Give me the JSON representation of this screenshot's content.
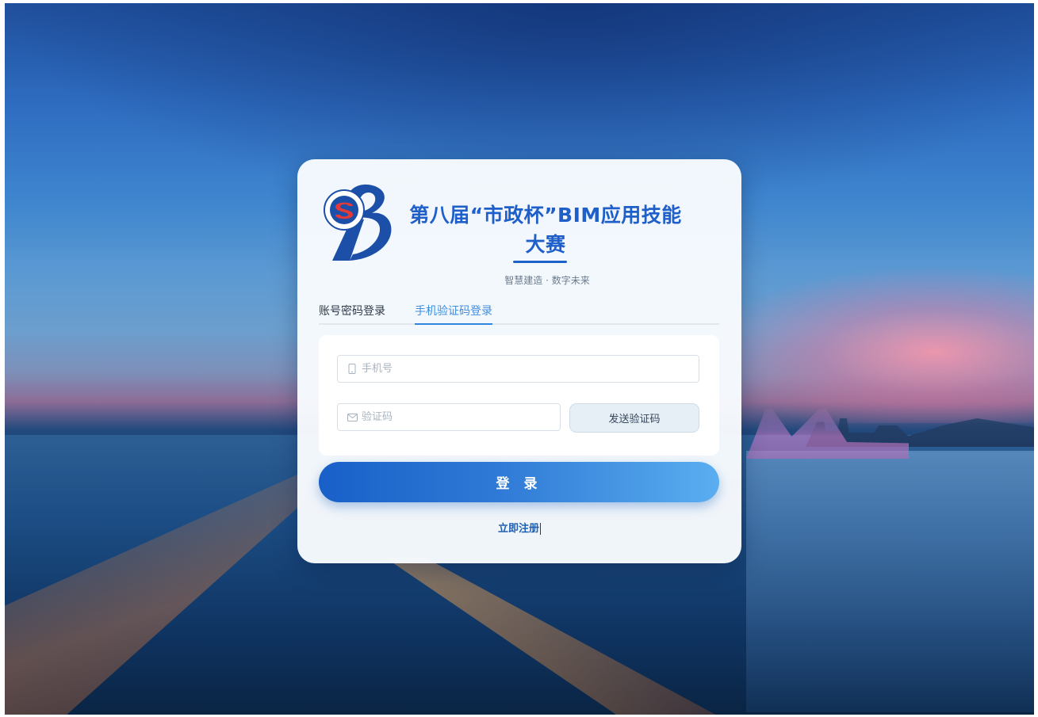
{
  "page": {
    "title_line1": "第八届“市政杯”BIM应用技能",
    "title_line2": "大赛",
    "subtitle": "智慧建造 · 数字未来"
  },
  "tabs": [
    {
      "label": "账号密码登录",
      "active": false
    },
    {
      "label": "手机验证码登录",
      "active": true
    }
  ],
  "form": {
    "phone_placeholder": "手机号",
    "code_placeholder": "验证码",
    "send_code_label": "发送验证码",
    "login_label": "登 录",
    "register_label": "立即注册"
  },
  "icons": {
    "phone": "mobile-phone-icon",
    "code": "envelope-icon"
  },
  "colors": {
    "brand": "#1f5fc9",
    "tab_active": "#3f8ee0",
    "button_start": "#1860c8",
    "button_end": "#5aaef0"
  }
}
